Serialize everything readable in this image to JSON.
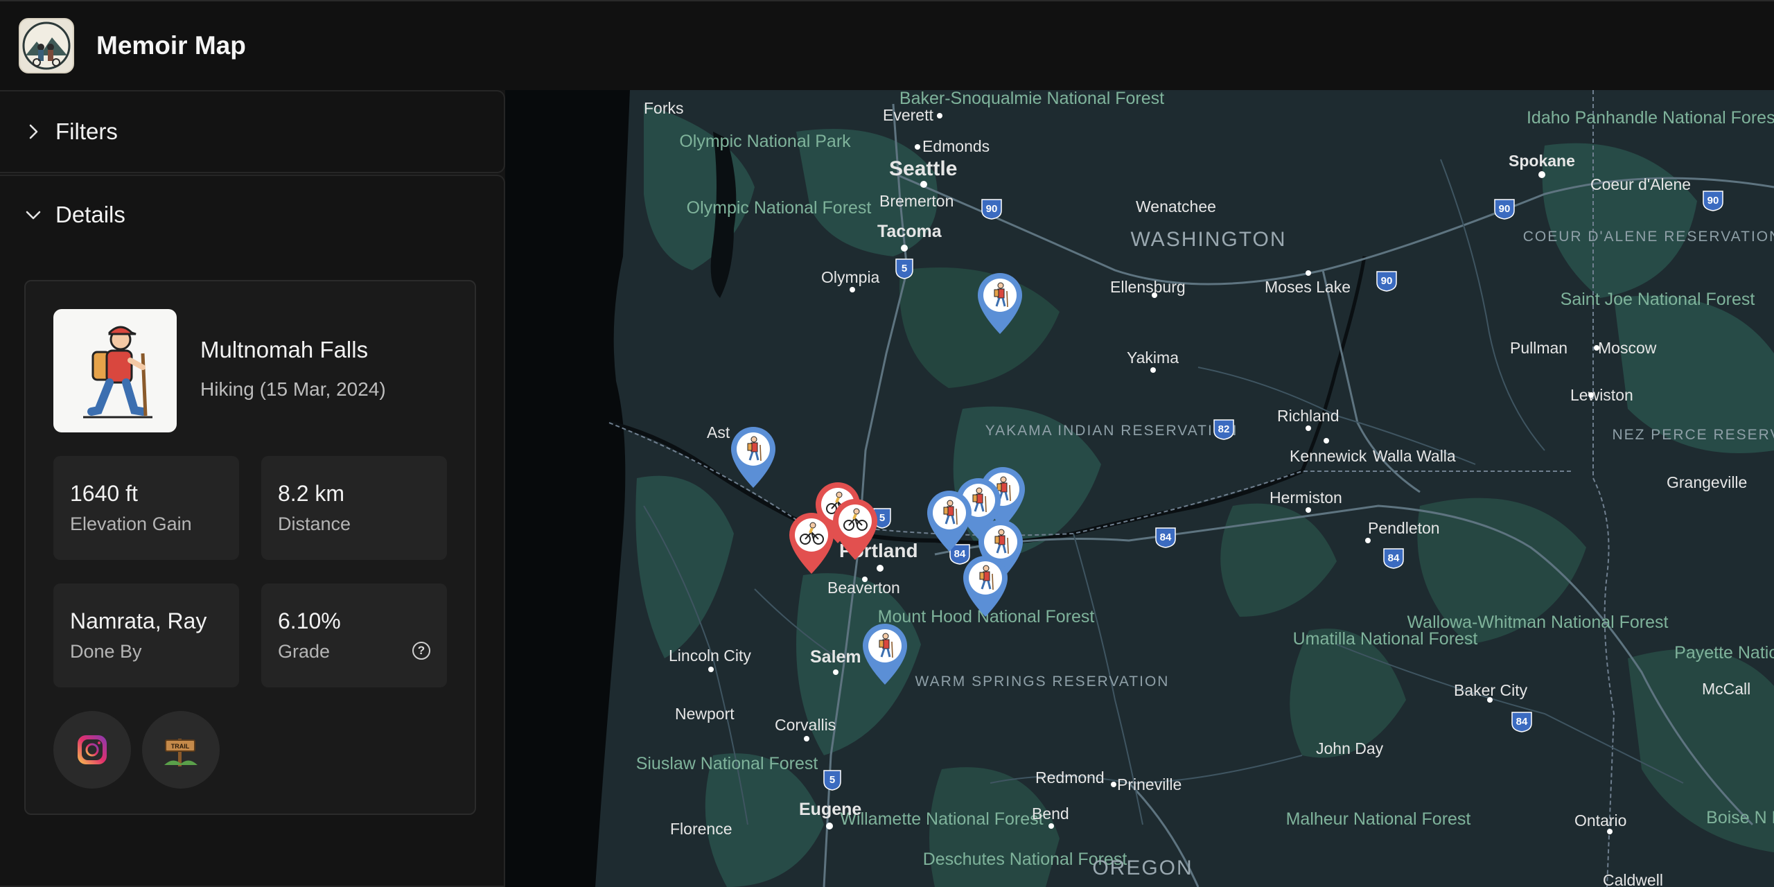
{
  "app": {
    "title": "Memoir Map"
  },
  "sidebar": {
    "filters_label": "Filters",
    "details_label": "Details"
  },
  "details": {
    "name": "Multnomah Falls",
    "subtitle": "Hiking (15 Mar, 2024)",
    "stats": [
      {
        "value": "1640 ft",
        "label": "Elevation Gain"
      },
      {
        "value": "8.2 km",
        "label": "Distance"
      },
      {
        "value": "Namrata, Ray",
        "label": "Done By"
      },
      {
        "value": "6.10%",
        "label": "Grade"
      }
    ],
    "help_glyph": "?",
    "links": [
      "instagram-icon",
      "trail-sign-icon"
    ]
  },
  "map": {
    "cities": [
      {
        "name": "Forks"
      },
      {
        "name": "Everett"
      },
      {
        "name": "Edmonds"
      },
      {
        "name": "Seattle"
      },
      {
        "name": "Bremerton"
      },
      {
        "name": "Tacoma"
      },
      {
        "name": "Olympia"
      },
      {
        "name": "Wenatchee"
      },
      {
        "name": "Ellensburg"
      },
      {
        "name": "Moses Lake"
      },
      {
        "name": "Spokane"
      },
      {
        "name": "Coeur d'Alene"
      },
      {
        "name": "Yakima"
      },
      {
        "name": "Pullman"
      },
      {
        "name": "Moscow"
      },
      {
        "name": "Lewiston"
      },
      {
        "name": "Richland"
      },
      {
        "name": "Kennewick"
      },
      {
        "name": "Walla Walla"
      },
      {
        "name": "Hermiston"
      },
      {
        "name": "Pendleton"
      },
      {
        "name": "Grangeville"
      },
      {
        "name": "Portland"
      },
      {
        "name": "Beaverton"
      },
      {
        "name": "Salem"
      },
      {
        "name": "Lincoln City"
      },
      {
        "name": "Newport"
      },
      {
        "name": "Corvallis"
      },
      {
        "name": "Eugene"
      },
      {
        "name": "Florence"
      },
      {
        "name": "Redmond"
      },
      {
        "name": "Prineville"
      },
      {
        "name": "Bend"
      },
      {
        "name": "Baker City"
      },
      {
        "name": "John Day"
      },
      {
        "name": "Ontario"
      },
      {
        "name": "McCall"
      },
      {
        "name": "Ast"
      },
      {
        "name": "Caldwell"
      }
    ],
    "regions": [
      {
        "name": "Baker-Snoqualmie National Forest"
      },
      {
        "name": "Olympic National Park"
      },
      {
        "name": "Olympic National Forest"
      },
      {
        "name": "WASHINGTON"
      },
      {
        "name": "COEUR D'ALENE RESERVATION"
      },
      {
        "name": "Saint Joe National Forest"
      },
      {
        "name": "Idaho Panhandle National Forests"
      },
      {
        "name": "YAKAMA INDIAN RESERVATION"
      },
      {
        "name": "NEZ PERCE RESERVATION"
      },
      {
        "name": "Mount Hood National Forest"
      },
      {
        "name": "Umatilla National Forest"
      },
      {
        "name": "Wallowa-Whitman National Forest"
      },
      {
        "name": "WARM SPRINGS RESERVATION"
      },
      {
        "name": "Siuslaw National Forest"
      },
      {
        "name": "Willamette National Forest"
      },
      {
        "name": "Deschutes National Forest"
      },
      {
        "name": "Malheur National Forest"
      },
      {
        "name": "OREGON"
      },
      {
        "name": "Payette National F"
      },
      {
        "name": "Boise N Fo"
      }
    ],
    "highway_shields": [
      "90",
      "90",
      "90",
      "90",
      "5",
      "5",
      "82",
      "84",
      "84",
      "84",
      "84",
      "5"
    ],
    "markers": [
      {
        "type": "hiking",
        "color": "#5b8fd6"
      },
      {
        "type": "hiking",
        "color": "#5b8fd6"
      },
      {
        "type": "biking",
        "color": "#e2504f"
      },
      {
        "type": "biking",
        "color": "#e2504f"
      },
      {
        "type": "biking",
        "color": "#e2504f"
      },
      {
        "type": "hiking",
        "color": "#5b8fd6"
      },
      {
        "type": "hiking",
        "color": "#5b8fd6"
      },
      {
        "type": "hiking",
        "color": "#5b8fd6"
      },
      {
        "type": "hiking",
        "color": "#5b8fd6"
      },
      {
        "type": "hiking",
        "color": "#5b8fd6"
      },
      {
        "type": "hiking",
        "color": "#5b8fd6"
      }
    ]
  },
  "colors": {
    "hike_marker": "#5b8fd6",
    "bike_marker": "#e2504f",
    "land": "#1e2b30",
    "forest": "#274b47",
    "ocean": "#070a0c"
  }
}
